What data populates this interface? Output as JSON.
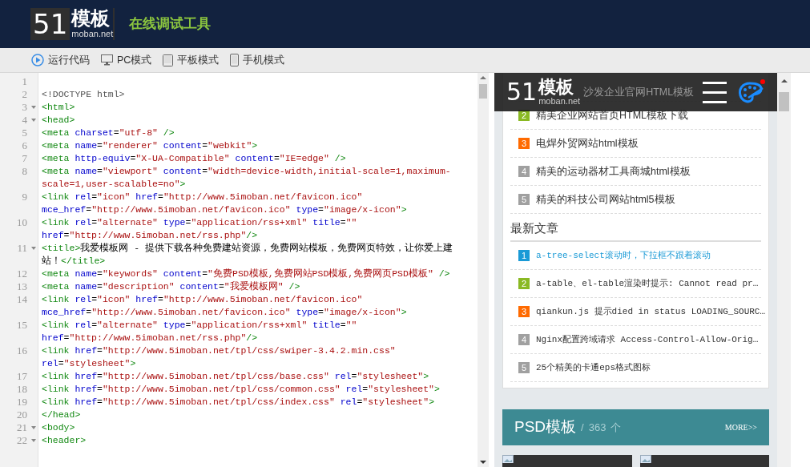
{
  "header": {
    "logo_mark": "51",
    "logo_name": "模板",
    "logo_domain": "moban.net",
    "tagline": "在线调试工具"
  },
  "toolbar": [
    {
      "kind": "run",
      "label": "运行代码"
    },
    {
      "kind": "pc",
      "label": "PC模式"
    },
    {
      "kind": "tablet",
      "label": "平板模式"
    },
    {
      "kind": "phone",
      "label": "手机模式"
    }
  ],
  "editor": {
    "lines": [
      {
        "number": "1",
        "fold": false
      },
      {
        "number": "2",
        "fold": false,
        "tokens": [
          {
            "kind": "doctype",
            "text": "<!DOCTYPE html>"
          }
        ]
      },
      {
        "number": "3",
        "fold": true,
        "tokens": [
          {
            "kind": "tag",
            "text": "<html>"
          }
        ]
      },
      {
        "number": "4",
        "fold": true,
        "tokens": [
          {
            "kind": "tag",
            "text": "<head>"
          }
        ]
      },
      {
        "number": "5",
        "fold": false,
        "tokens": [
          {
            "kind": "tag",
            "text": "<meta "
          },
          {
            "kind": "attr",
            "text": "charset"
          },
          {
            "kind": "text",
            "text": "="
          },
          {
            "kind": "value",
            "text": "\"utf-8\""
          },
          {
            "kind": "tag",
            "text": " />"
          }
        ]
      },
      {
        "number": "6",
        "fold": false,
        "tokens": [
          {
            "kind": "tag",
            "text": "<meta "
          },
          {
            "kind": "attr",
            "text": "name"
          },
          {
            "kind": "text",
            "text": "="
          },
          {
            "kind": "value",
            "text": "\"renderer\""
          },
          {
            "kind": "attr",
            "text": " content"
          },
          {
            "kind": "text",
            "text": "="
          },
          {
            "kind": "value",
            "text": "\"webkit\""
          },
          {
            "kind": "tag",
            "text": ">"
          }
        ]
      },
      {
        "number": "7",
        "fold": false,
        "tokens": [
          {
            "kind": "tag",
            "text": "<meta "
          },
          {
            "kind": "attr",
            "text": "http-equiv"
          },
          {
            "kind": "text",
            "text": "="
          },
          {
            "kind": "value",
            "text": "\"X-UA-Compatible\""
          },
          {
            "kind": "attr",
            "text": " content"
          },
          {
            "kind": "text",
            "text": "="
          },
          {
            "kind": "value",
            "text": "\"IE=edge\""
          },
          {
            "kind": "tag",
            "text": " />"
          }
        ]
      },
      {
        "number": "8",
        "fold": false,
        "tokens": [
          {
            "kind": "tag",
            "text": "<meta "
          },
          {
            "kind": "attr",
            "text": "name"
          },
          {
            "kind": "text",
            "text": "="
          },
          {
            "kind": "value",
            "text": "\"viewport\""
          },
          {
            "kind": "attr",
            "text": " content"
          },
          {
            "kind": "text",
            "text": "="
          },
          {
            "kind": "value",
            "text": "\"width=device-width,initial-scale=1,maximum-scale=1,user-scalable=no\""
          },
          {
            "kind": "tag",
            "text": ">"
          }
        ]
      },
      {
        "number": "9",
        "fold": false,
        "tokens": [
          {
            "kind": "tag",
            "text": "<link "
          },
          {
            "kind": "attr",
            "text": "rel"
          },
          {
            "kind": "text",
            "text": "="
          },
          {
            "kind": "value",
            "text": "\"icon\""
          },
          {
            "kind": "attr",
            "text": " href"
          },
          {
            "kind": "text",
            "text": "="
          },
          {
            "kind": "value",
            "text": "\"http://www.5imoban.net/favicon.ico\""
          },
          {
            "kind": "attr",
            "text": " mce_href"
          },
          {
            "kind": "text",
            "text": "="
          },
          {
            "kind": "value",
            "text": "\"http://www.5imoban.net/favicon.ico\""
          },
          {
            "kind": "attr",
            "text": " type"
          },
          {
            "kind": "text",
            "text": "="
          },
          {
            "kind": "value",
            "text": "\"image/x-icon\""
          },
          {
            "kind": "tag",
            "text": ">"
          }
        ]
      },
      {
        "number": "10",
        "fold": false,
        "tokens": [
          {
            "kind": "tag",
            "text": "<link "
          },
          {
            "kind": "attr",
            "text": "rel"
          },
          {
            "kind": "text",
            "text": "="
          },
          {
            "kind": "value",
            "text": "\"alternate\""
          },
          {
            "kind": "attr",
            "text": " type"
          },
          {
            "kind": "text",
            "text": "="
          },
          {
            "kind": "value",
            "text": "\"application/rss+xml\""
          },
          {
            "kind": "attr",
            "text": " title"
          },
          {
            "kind": "text",
            "text": "="
          },
          {
            "kind": "value",
            "text": "\"\""
          },
          {
            "kind": "attr",
            "text": " href"
          },
          {
            "kind": "text",
            "text": "="
          },
          {
            "kind": "value",
            "text": "\"http://www.5imoban.net/rss.php\""
          },
          {
            "kind": "tag",
            "text": "/>"
          }
        ]
      },
      {
        "number": "11",
        "fold": true,
        "tokens": [
          {
            "kind": "tag",
            "text": "<title>"
          },
          {
            "kind": "text",
            "text": "我爱模板网 - 提供下载各种免费建站资源，免费网站模板，免费网页特效，让你爱上建站！"
          },
          {
            "kind": "tag",
            "text": "</title>"
          }
        ]
      },
      {
        "number": "12",
        "fold": false,
        "tokens": [
          {
            "kind": "tag",
            "text": "<meta "
          },
          {
            "kind": "attr",
            "text": "name"
          },
          {
            "kind": "text",
            "text": "="
          },
          {
            "kind": "value",
            "text": "\"keywords\""
          },
          {
            "kind": "attr",
            "text": " content"
          },
          {
            "kind": "text",
            "text": "="
          },
          {
            "kind": "value",
            "text": "\"免费PSD模板,免费网站PSD模板,免费网页PSD模板\""
          },
          {
            "kind": "tag",
            "text": " />"
          }
        ]
      },
      {
        "number": "13",
        "fold": false,
        "tokens": [
          {
            "kind": "tag",
            "text": "<meta "
          },
          {
            "kind": "attr",
            "text": "name"
          },
          {
            "kind": "text",
            "text": "="
          },
          {
            "kind": "value",
            "text": "\"description\""
          },
          {
            "kind": "attr",
            "text": " content"
          },
          {
            "kind": "text",
            "text": "="
          },
          {
            "kind": "value",
            "text": "\"我爱模板网\""
          },
          {
            "kind": "tag",
            "text": " />"
          }
        ]
      },
      {
        "number": "14",
        "fold": false,
        "tokens": [
          {
            "kind": "tag",
            "text": "<link "
          },
          {
            "kind": "attr",
            "text": "rel"
          },
          {
            "kind": "text",
            "text": "="
          },
          {
            "kind": "value",
            "text": "\"icon\""
          },
          {
            "kind": "attr",
            "text": " href"
          },
          {
            "kind": "text",
            "text": "="
          },
          {
            "kind": "value",
            "text": "\"http://www.5imoban.net/favicon.ico\""
          },
          {
            "kind": "attr",
            "text": " mce_href"
          },
          {
            "kind": "text",
            "text": "="
          },
          {
            "kind": "value",
            "text": "\"http://www.5imoban.net/favicon.ico\""
          },
          {
            "kind": "attr",
            "text": " type"
          },
          {
            "kind": "text",
            "text": "="
          },
          {
            "kind": "value",
            "text": "\"image/x-icon\""
          },
          {
            "kind": "tag",
            "text": ">"
          }
        ]
      },
      {
        "number": "15",
        "fold": false,
        "tokens": [
          {
            "kind": "tag",
            "text": "<link "
          },
          {
            "kind": "attr",
            "text": "rel"
          },
          {
            "kind": "text",
            "text": "="
          },
          {
            "kind": "value",
            "text": "\"alternate\""
          },
          {
            "kind": "attr",
            "text": " type"
          },
          {
            "kind": "text",
            "text": "="
          },
          {
            "kind": "value",
            "text": "\"application/rss+xml\""
          },
          {
            "kind": "attr",
            "text": " title"
          },
          {
            "kind": "text",
            "text": "="
          },
          {
            "kind": "value",
            "text": "\"\""
          },
          {
            "kind": "attr",
            "text": " href"
          },
          {
            "kind": "text",
            "text": "="
          },
          {
            "kind": "value",
            "text": "\"http://www.5imoban.net/rss.php\""
          },
          {
            "kind": "tag",
            "text": "/>"
          }
        ]
      },
      {
        "number": "16",
        "fold": false,
        "tokens": [
          {
            "kind": "tag",
            "text": "<link "
          },
          {
            "kind": "attr",
            "text": "href"
          },
          {
            "kind": "text",
            "text": "="
          },
          {
            "kind": "value",
            "text": "\"http://www.5imoban.net/tpl/css/swiper-3.4.2.min.css\""
          },
          {
            "kind": "attr",
            "text": " rel"
          },
          {
            "kind": "text",
            "text": "="
          },
          {
            "kind": "value",
            "text": "\"stylesheet\""
          },
          {
            "kind": "tag",
            "text": ">"
          }
        ]
      },
      {
        "number": "17",
        "fold": false,
        "tokens": [
          {
            "kind": "tag",
            "text": "<link "
          },
          {
            "kind": "attr",
            "text": "href"
          },
          {
            "kind": "text",
            "text": "="
          },
          {
            "kind": "value",
            "text": "\"http://www.5imoban.net/tpl/css/base.css\""
          },
          {
            "kind": "attr",
            "text": " rel"
          },
          {
            "kind": "text",
            "text": "="
          },
          {
            "kind": "value",
            "text": "\"stylesheet\""
          },
          {
            "kind": "tag",
            "text": ">"
          }
        ]
      },
      {
        "number": "18",
        "fold": false,
        "tokens": [
          {
            "kind": "tag",
            "text": "<link "
          },
          {
            "kind": "attr",
            "text": "href"
          },
          {
            "kind": "text",
            "text": "="
          },
          {
            "kind": "value",
            "text": "\"http://www.5imoban.net/tpl/css/common.css\""
          },
          {
            "kind": "attr",
            "text": " rel"
          },
          {
            "kind": "text",
            "text": "="
          },
          {
            "kind": "value",
            "text": "\"stylesheet\""
          },
          {
            "kind": "tag",
            "text": ">"
          }
        ]
      },
      {
        "number": "19",
        "fold": false,
        "tokens": [
          {
            "kind": "tag",
            "text": "<link "
          },
          {
            "kind": "attr",
            "text": "href"
          },
          {
            "kind": "text",
            "text": "="
          },
          {
            "kind": "value",
            "text": "\"http://www.5imoban.net/tpl/css/index.css\""
          },
          {
            "kind": "attr",
            "text": " rel"
          },
          {
            "kind": "text",
            "text": "="
          },
          {
            "kind": "value",
            "text": "\"stylesheet\""
          },
          {
            "kind": "tag",
            "text": ">"
          }
        ]
      },
      {
        "number": "20",
        "fold": false,
        "tokens": [
          {
            "kind": "tag",
            "text": "</head>"
          }
        ]
      },
      {
        "number": "21",
        "fold": true,
        "tokens": [
          {
            "kind": "tag",
            "text": "<body>"
          }
        ]
      },
      {
        "number": "22",
        "fold": true,
        "tokens": [
          {
            "kind": "tag",
            "text": "<header>"
          }
        ]
      }
    ]
  },
  "preview": {
    "logo_mark": "51",
    "logo_name": "模板",
    "logo_domain": "moban.net",
    "partial_item": "沙发企业官网HTML模板",
    "top_list": [
      {
        "number": "2",
        "color": "#8ab923",
        "title": "精美企业网站首页HTML模板下载"
      },
      {
        "number": "3",
        "color": "#ff6a00",
        "title": "电焊外贸网站html模板"
      },
      {
        "number": "4",
        "color": "#a0a0a0",
        "title": "精美的运动器材工具商城html模板"
      },
      {
        "number": "5",
        "color": "#a0a0a0",
        "title": "精美的科技公司网站html5模板"
      }
    ],
    "articles_heading": "最新文章",
    "articles": [
      {
        "number": "1",
        "color": "#1a9ad6",
        "selected": true,
        "title": "a-tree-select滚动时，下拉框不跟着滚动"
      },
      {
        "number": "2",
        "color": "#8ab923",
        "selected": false,
        "title": "a-table、el-table渲染时提示: Cannot read pr…"
      },
      {
        "number": "3",
        "color": "#ff6a00",
        "selected": false,
        "title": "qiankun.js 提示died in status LOADING_SOURC…"
      },
      {
        "number": "4",
        "color": "#a0a0a0",
        "selected": false,
        "title": "Nginx配置跨域请求 Access-Control-Allow-Orig…"
      },
      {
        "number": "5",
        "color": "#a0a0a0",
        "selected": false,
        "title": "25个精美的卡通eps格式图标"
      }
    ],
    "section": {
      "title": "PSD模板",
      "separator": "/",
      "count": "363",
      "unit": "个",
      "more": "MORE>>"
    }
  }
}
